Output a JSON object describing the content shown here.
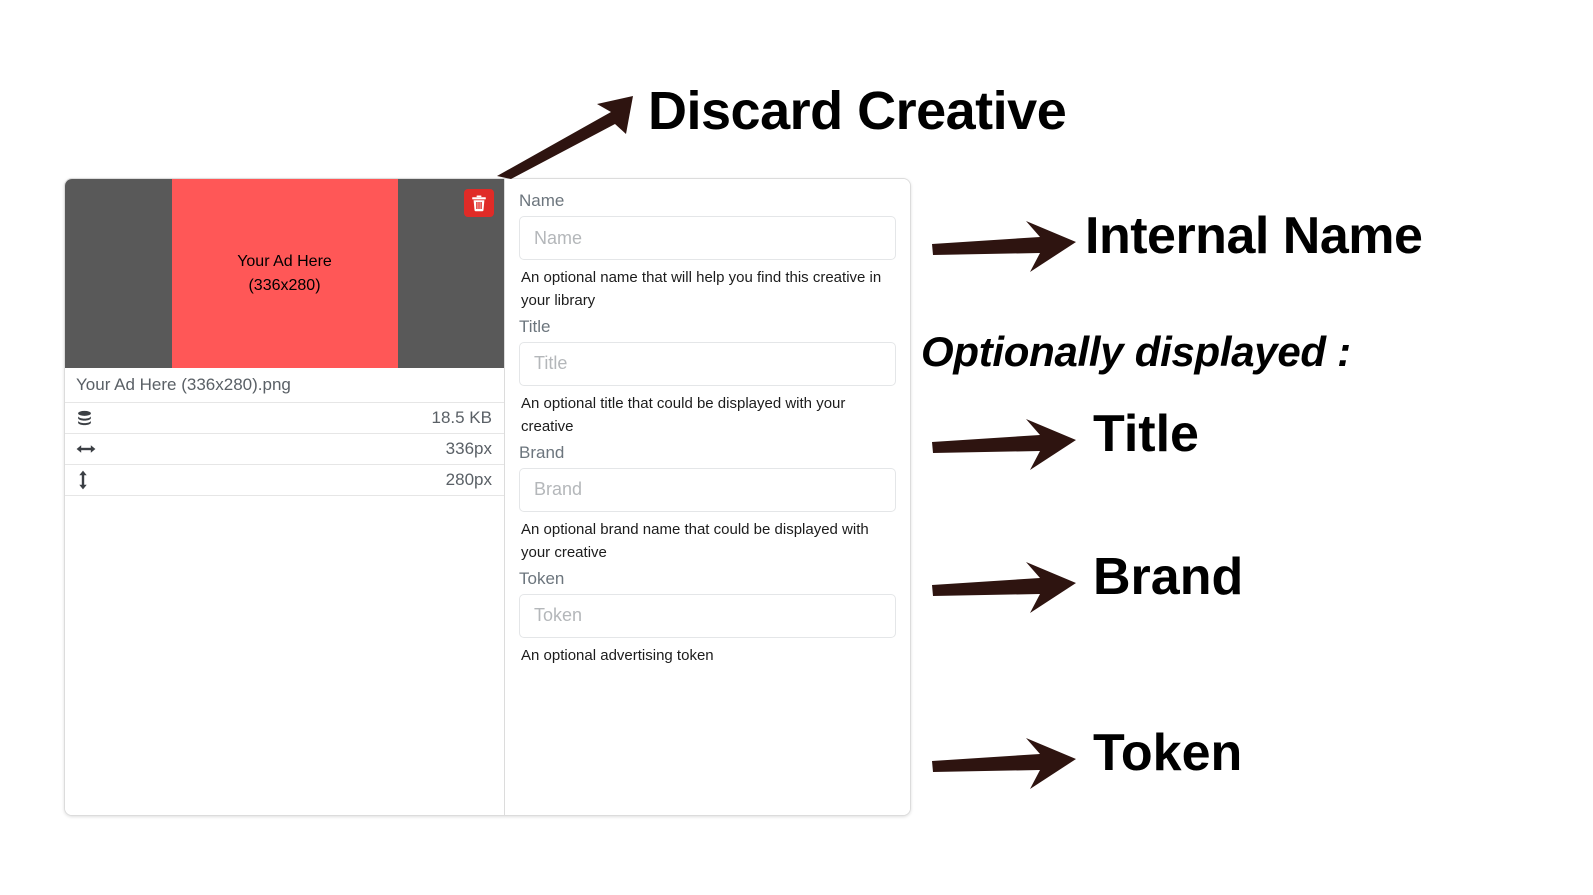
{
  "creative_card": {
    "preview": {
      "discard_button": {
        "icon": "trash-icon",
        "color": "#e02b27"
      },
      "ad_banner": {
        "headline": "Your Ad Here",
        "size_label": "(336x280)",
        "background_color": "#ff5757",
        "letterbox_color": "#595959"
      },
      "file_name": "Your Ad Here (336x280).png",
      "meta_rows": [
        {
          "icon": "database-icon",
          "label": "file-size",
          "value": "18.5 KB"
        },
        {
          "icon": "arrows-horizontal-icon",
          "label": "width",
          "value": "336px"
        },
        {
          "icon": "arrows-vertical-icon",
          "label": "height",
          "value": "280px"
        }
      ]
    },
    "form": {
      "fields": [
        {
          "key": "name",
          "label": "Name",
          "placeholder": "Name",
          "value": "",
          "help": "An optional name that will help you find this creative in your library"
        },
        {
          "key": "title",
          "label": "Title",
          "placeholder": "Title",
          "value": "",
          "help": "An optional title that could be displayed with your creative"
        },
        {
          "key": "brand",
          "label": "Brand",
          "placeholder": "Brand",
          "value": "",
          "help": "An optional brand name that could be displayed with your creative"
        },
        {
          "key": "token",
          "label": "Token",
          "placeholder": "Token",
          "value": "",
          "help": "An optional advertising token"
        }
      ]
    }
  },
  "annotations": {
    "arrow_color": "#2e1410",
    "text_color": "#000000",
    "discard_creative": "Discard Creative",
    "internal_name": "Internal Name",
    "optionally_displayed": "Optionally displayed :",
    "title": "Title",
    "brand": "Brand",
    "token": "Token"
  }
}
